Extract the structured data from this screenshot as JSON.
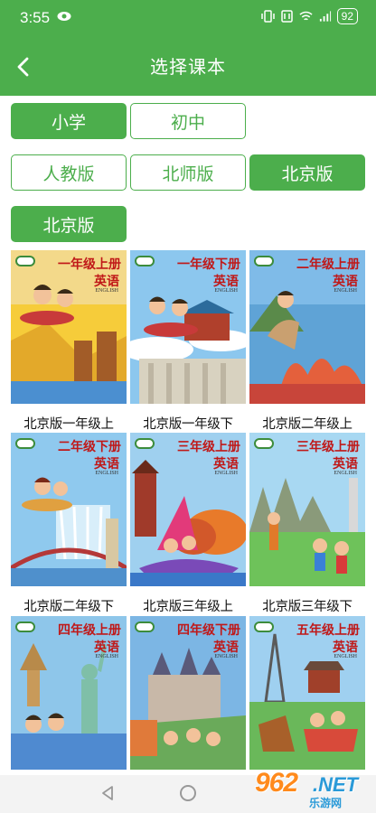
{
  "status_bar": {
    "time": "3:55",
    "battery": "92"
  },
  "header": {
    "title": "选择课本"
  },
  "level_tabs": [
    {
      "label": "小学",
      "selected": true
    },
    {
      "label": "初中",
      "selected": false
    }
  ],
  "edition_tabs": [
    {
      "label": "人教版",
      "selected": false
    },
    {
      "label": "北师版",
      "selected": false
    },
    {
      "label": "北京版",
      "selected": true
    }
  ],
  "sub_edition": {
    "label": "北京版",
    "selected": true
  },
  "books": [
    {
      "label": "北京版一年级上",
      "cover_title": "一年级上册",
      "cover_subject": "英语",
      "cover_en": "ENGLISH"
    },
    {
      "label": "北京版一年级下",
      "cover_title": "一年级下册",
      "cover_subject": "英语",
      "cover_en": "ENGLISH"
    },
    {
      "label": "北京版二年级上",
      "cover_title": "二年级上册",
      "cover_subject": "英语",
      "cover_en": "ENGLISH"
    },
    {
      "label": "北京版二年级下",
      "cover_title": "二年级下册",
      "cover_subject": "英语",
      "cover_en": "ENGLISH"
    },
    {
      "label": "北京版三年级上",
      "cover_title": "三年级上册",
      "cover_subject": "英语",
      "cover_en": "ENGLISH"
    },
    {
      "label": "北京版三年级下",
      "cover_title": "三年级上册",
      "cover_subject": "英语",
      "cover_en": "ENGLISH"
    },
    {
      "label": "",
      "cover_title": "四年级上册",
      "cover_subject": "英语",
      "cover_en": "ENGLISH"
    },
    {
      "label": "",
      "cover_title": "四年级下册",
      "cover_subject": "英语",
      "cover_en": "ENGLISH"
    },
    {
      "label": "",
      "cover_title": "五年级上册",
      "cover_subject": "英语",
      "cover_en": "ENGLISH"
    }
  ],
  "watermark": {
    "number": "962",
    "net": ".NET",
    "site": "乐游网"
  },
  "colors": {
    "accent": "#4cae4c",
    "cover_title": "#c01818"
  }
}
